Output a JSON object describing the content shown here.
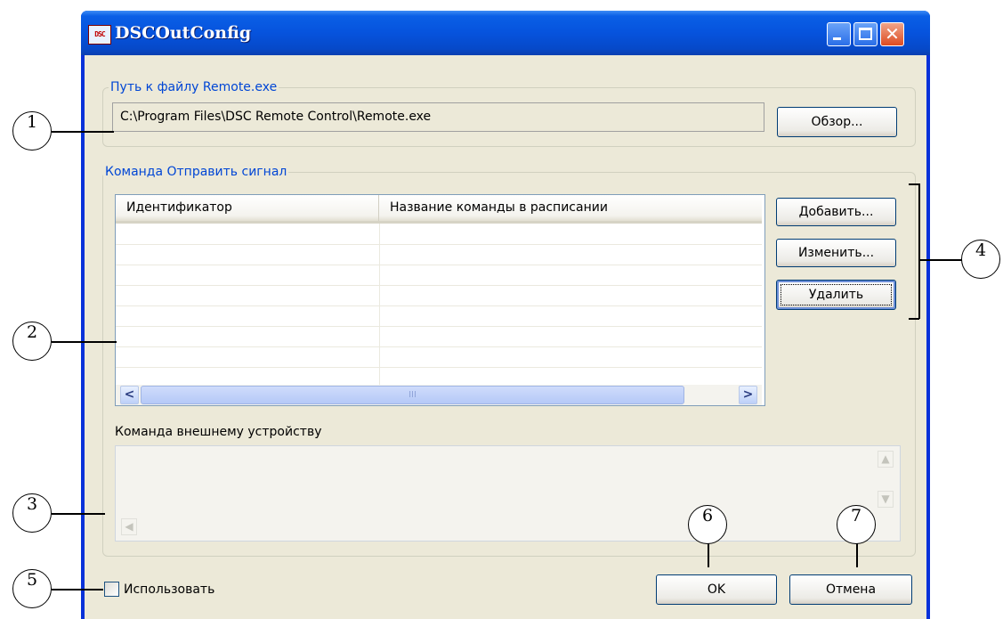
{
  "window": {
    "title": "DSCOutConfig",
    "icon_text": "DSC"
  },
  "path_group": {
    "label": "Путь к файлу Remote.exe",
    "path_value": "C:\\Program Files\\DSC Remote Control\\Remote.exe",
    "browse_label": "Обзор..."
  },
  "command_group": {
    "label": "Команда Отправить сигнал",
    "columns": [
      "Идентификатор",
      "Название команды в расписании"
    ],
    "add_label": "Добавить...",
    "edit_label": "Изменить...",
    "delete_label": "Удалить",
    "scroll_left": "<",
    "scroll_right": ">",
    "scroll_grip": "III"
  },
  "device_command": {
    "label": "Команда внешнему устройству"
  },
  "use_checkbox": {
    "label": "Использовать",
    "checked": false
  },
  "ok_label": "OK",
  "cancel_label": "Отмена",
  "callouts": [
    "1",
    "2",
    "3",
    "4",
    "5",
    "6",
    "7"
  ]
}
